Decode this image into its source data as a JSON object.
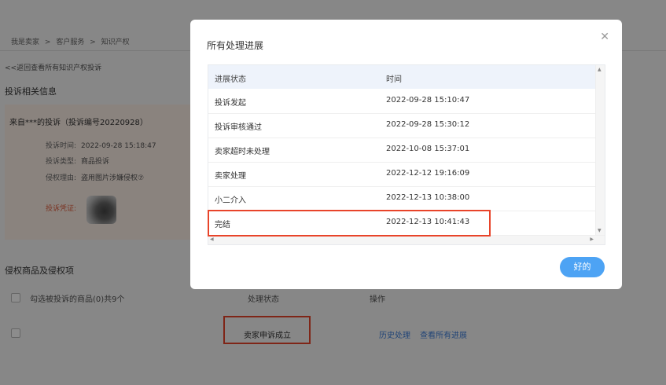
{
  "background": {
    "breadcrumb": [
      "我是卖家",
      ">",
      "客户服务",
      ">",
      "知识产权"
    ],
    "back_link": "<<返回查看所有知识产权投诉",
    "section_complaint": "投诉相关信息",
    "card": {
      "title": "来自***的投诉（投诉编号20220928）",
      "rows": [
        {
          "label": "投诉时间:",
          "value": "2022-09-28 15:18:47"
        },
        {
          "label": "投诉类型:",
          "value": "商品投诉"
        },
        {
          "label": "侵权理由:",
          "value": "盗用图片涉嫌侵权⑦"
        }
      ],
      "evidence_label": "投诉凭证:"
    },
    "section_items": "侵权商品及侵权项",
    "table_headers": [
      "勾选被投诉的商品(0)共9个",
      "处理状态",
      "操作"
    ],
    "row_status": "卖家申诉成立",
    "links": [
      "历史处理",
      "查看所有进展"
    ]
  },
  "modal": {
    "title": "所有处理进展",
    "close_icon": "close-icon",
    "columns": [
      "进展状态",
      "时间"
    ],
    "rows": [
      {
        "status": "投诉发起",
        "time": "2022-09-28 15:10:47"
      },
      {
        "status": "投诉审核通过",
        "time": "2022-09-28 15:30:12"
      },
      {
        "status": "卖家超时未处理",
        "time": "2022-10-08 15:37:01"
      },
      {
        "status": "卖家处理",
        "time": "2022-12-12 19:16:09"
      },
      {
        "status": "小二介入",
        "time": "2022-12-13 10:38:00"
      },
      {
        "status": "完结",
        "time": "2022-12-13 10:41:43"
      }
    ],
    "ok_label": "好的"
  },
  "colors": {
    "highlight": "#e8442a",
    "primary": "#4da3f4",
    "header_bg": "#eef3fb"
  }
}
